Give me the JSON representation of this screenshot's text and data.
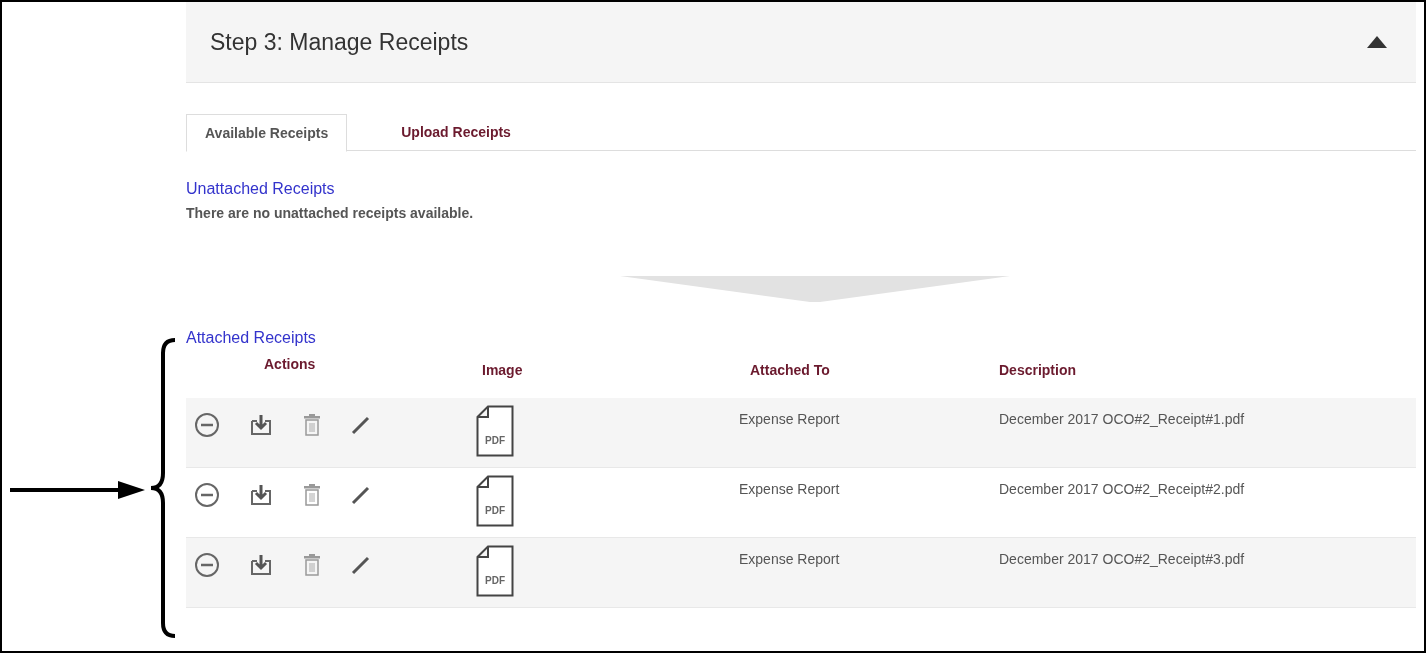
{
  "section": {
    "title": "Step 3: Manage Receipts",
    "expanded": true
  },
  "tabs": [
    {
      "label": "Available Receipts",
      "selected": true
    },
    {
      "label": "Upload Receipts",
      "selected": false
    }
  ],
  "unattached": {
    "heading": "Unattached Receipts",
    "message": "There are no unattached receipts available."
  },
  "attached": {
    "heading": "Attached Receipts",
    "columns": [
      "Actions",
      "Image",
      "Attached To",
      "Description"
    ],
    "rows": [
      {
        "attached_to": "Expense Report",
        "description": "December 2017 OCO#2_Receipt#1.pdf",
        "file_type": "PDF"
      },
      {
        "attached_to": "Expense Report",
        "description": "December 2017 OCO#2_Receipt#2.pdf",
        "file_type": "PDF"
      },
      {
        "attached_to": "Expense Report",
        "description": "December 2017 OCO#2_Receipt#3.pdf",
        "file_type": "PDF"
      }
    ]
  }
}
